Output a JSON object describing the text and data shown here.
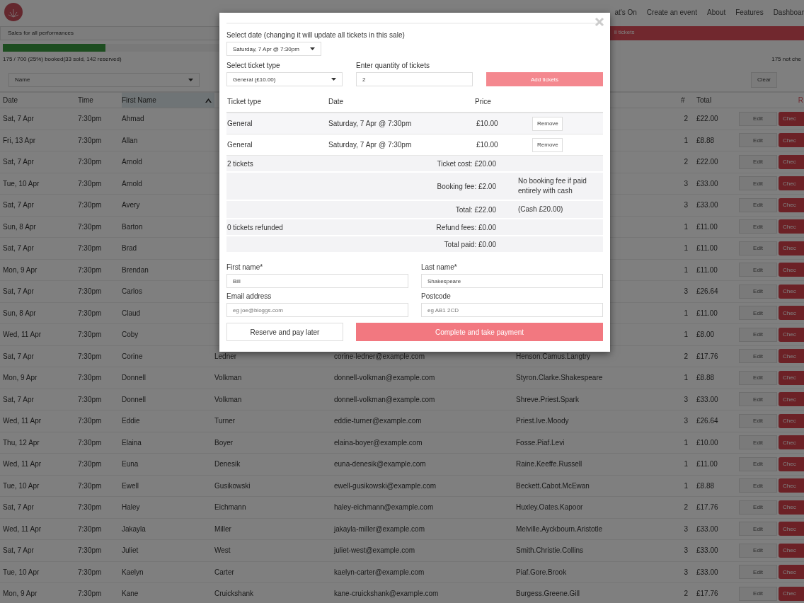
{
  "nav": {
    "links": [
      "at's On",
      "Create an event",
      "About",
      "Features",
      "Dashboar"
    ]
  },
  "sales": {
    "performance_select": "Sales for all performances",
    "alert": "ll tickets",
    "progress": {
      "level": 0.25
    },
    "booked_text": "175 / 700 (25%) booked(33 sold, 142 reserved)",
    "not_checked_text": "175 not che"
  },
  "filter": {
    "field_select": "Name",
    "clear_button": "Clear"
  },
  "table": {
    "columns": [
      {
        "label": "Date",
        "sorted": false
      },
      {
        "label": "Time",
        "sorted": false
      },
      {
        "label": "First Name",
        "sorted": true
      },
      {
        "label": "#",
        "sorted": false
      },
      {
        "label": "Total",
        "sorted": false
      },
      {
        "label": "R",
        "sorted": false
      }
    ],
    "rows": [
      {
        "date": "Sat, 7 Apr",
        "time": "7:30pm",
        "first_name": "Ahmad",
        "count": "2",
        "total": "£22.00",
        "edit": "Edit",
        "check": "Chec"
      },
      {
        "date": "Fri, 13 Apr",
        "time": "7:30pm",
        "first_name": "Allan",
        "count": "1",
        "total": "£8.88",
        "edit": "Edit",
        "check": "Chec"
      },
      {
        "date": "Sat, 7 Apr",
        "time": "7:30pm",
        "first_name": "Arnold",
        "count": "2",
        "total": "£22.00",
        "edit": "Edit",
        "check": "Chec"
      },
      {
        "date": "Tue, 10 Apr",
        "time": "7:30pm",
        "first_name": "Arnold",
        "count": "3",
        "total": "£33.00",
        "edit": "Edit",
        "check": "Chec"
      },
      {
        "date": "Sat, 7 Apr",
        "time": "7:30pm",
        "first_name": "Avery",
        "count": "3",
        "total": "£33.00",
        "edit": "Edit",
        "check": "Chec"
      },
      {
        "date": "Sun, 8 Apr",
        "time": "7:30pm",
        "first_name": "Barton",
        "count": "1",
        "total": "£11.00",
        "edit": "Edit",
        "check": "Chec"
      },
      {
        "date": "Sat, 7 Apr",
        "time": "7:30pm",
        "first_name": "Brad",
        "count": "1",
        "total": "£11.00",
        "edit": "Edit",
        "check": "Chec"
      },
      {
        "date": "Mon, 9 Apr",
        "time": "7:30pm",
        "first_name": "Brendan",
        "count": "1",
        "total": "£11.00",
        "edit": "Edit",
        "check": "Chec"
      },
      {
        "date": "Sat, 7 Apr",
        "time": "7:30pm",
        "first_name": "Carlos",
        "count": "3",
        "total": "£26.64",
        "edit": "Edit",
        "check": "Chec"
      },
      {
        "date": "Sun, 8 Apr",
        "time": "7:30pm",
        "first_name": "Claud",
        "count": "1",
        "total": "£11.00",
        "edit": "Edit",
        "check": "Chec"
      },
      {
        "date": "Wed, 11 Apr",
        "time": "7:30pm",
        "first_name": "Coby",
        "count": "1",
        "total": "£8.00",
        "edit": "Edit",
        "check": "Chec"
      },
      {
        "date": "Sat, 7 Apr",
        "time": "7:30pm",
        "first_name": "Corine",
        "last_name": "Ledner",
        "email": "corine-ledner@example.com",
        "seats": "Henson.Camus.Langtry",
        "count": "2",
        "total": "£17.76",
        "edit": "Edit",
        "check": "Chec"
      },
      {
        "date": "Mon, 9 Apr",
        "time": "7:30pm",
        "first_name": "Donnell",
        "last_name": "Volkman",
        "email": "donnell-volkman@example.com",
        "seats": "Styron.Clarke.Shakespeare",
        "count": "1",
        "total": "£8.88",
        "edit": "Edit",
        "check": "Chec"
      },
      {
        "date": "Sat, 7 Apr",
        "time": "7:30pm",
        "first_name": "Donnell",
        "last_name": "Volkman",
        "email": "donnell-volkman@example.com",
        "seats": "Shreve.Priest.Spark",
        "count": "3",
        "total": "£33.00",
        "edit": "Edit",
        "check": "Chec"
      },
      {
        "date": "Wed, 11 Apr",
        "time": "7:30pm",
        "first_name": "Eddie",
        "last_name": "Turner",
        "email": "eddie-turner@example.com",
        "seats": "Priest.Ive.Moody",
        "count": "3",
        "total": "£26.64",
        "edit": "Edit",
        "check": "Chec"
      },
      {
        "date": "Thu, 12 Apr",
        "time": "7:30pm",
        "first_name": "Elaina",
        "last_name": "Boyer",
        "email": "elaina-boyer@example.com",
        "seats": "Fosse.Piaf.Levi",
        "count": "1",
        "total": "£10.00",
        "edit": "Edit",
        "check": "Chec"
      },
      {
        "date": "Wed, 11 Apr",
        "time": "7:30pm",
        "first_name": "Euna",
        "last_name": "Denesik",
        "email": "euna-denesik@example.com",
        "seats": "Raine.Keeffe.Russell",
        "count": "1",
        "total": "£11.00",
        "edit": "Edit",
        "check": "Chec"
      },
      {
        "date": "Tue, 10 Apr",
        "time": "7:30pm",
        "first_name": "Ewell",
        "last_name": "Gusikowski",
        "email": "ewell-gusikowski@example.com",
        "seats": "Beckett.Cabot.McEwan",
        "count": "1",
        "total": "£8.88",
        "edit": "Edit",
        "check": "Chec"
      },
      {
        "date": "Sat, 7 Apr",
        "time": "7:30pm",
        "first_name": "Haley",
        "last_name": "Eichmann",
        "email": "haley-eichmann@example.com",
        "seats": "Huxley.Oates.Kapoor",
        "count": "2",
        "total": "£17.76",
        "edit": "Edit",
        "check": "Chec"
      },
      {
        "date": "Wed, 11 Apr",
        "time": "7:30pm",
        "first_name": "Jakayla",
        "last_name": "Miller",
        "email": "jakayla-miller@example.com",
        "seats": "Melville.Ayckbourn.Aristotle",
        "count": "3",
        "total": "£33.00",
        "edit": "Edit",
        "check": "Chec"
      },
      {
        "date": "Sat, 7 Apr",
        "time": "7:30pm",
        "first_name": "Juliet",
        "last_name": "West",
        "email": "juliet-west@example.com",
        "seats": "Smith.Christie.Collins",
        "count": "3",
        "total": "£33.00",
        "edit": "Edit",
        "check": "Chec"
      },
      {
        "date": "Tue, 10 Apr",
        "time": "7:30pm",
        "first_name": "Kaelyn",
        "last_name": "Carter",
        "email": "kaelyn-carter@example.com",
        "seats": "Piaf.Gore.Brook",
        "count": "3",
        "total": "£33.00",
        "edit": "Edit",
        "check": "Chec"
      },
      {
        "date": "Mon, 9 Apr",
        "time": "7:30pm",
        "first_name": "Kane",
        "last_name": "Cruickshank",
        "email": "kane-cruickshank@example.com",
        "seats": "Burgess.Greene.Gill",
        "count": "2",
        "total": "£17.76",
        "edit": "Edit",
        "check": "Chec"
      }
    ]
  },
  "modal": {
    "date_label": "Select date (changing it will update all tickets in this sale)",
    "date_value": "Saturday, 7 Apr @ 7:30pm",
    "ticket_type_label": "Select ticket type",
    "ticket_type_value": "General (£10.00)",
    "quantity_label": "Enter quantity of tickets",
    "quantity_value": "2",
    "add_button": "Add tickets",
    "ticket_columns": [
      "Ticket type",
      "Date",
      "Price"
    ],
    "tickets": [
      {
        "type": "General",
        "date": "Saturday, 7 Apr @ 7:30pm",
        "price": "£10.00",
        "action": "Remove"
      },
      {
        "type": "General",
        "date": "Saturday, 7 Apr @ 7:30pm",
        "price": "£10.00",
        "action": "Remove"
      }
    ],
    "summary": [
      {
        "left": "2 tickets",
        "middle": "Ticket cost: £20.00"
      },
      {
        "middle": "Booking fee: £2.00",
        "right": "No booking fee if paid entirely with cash"
      },
      {
        "middle": "Total: £22.00",
        "right": "(Cash £20.00)"
      },
      {
        "left": "0 tickets refunded",
        "middle": "Refund fees: £0.00"
      },
      {
        "middle": "Total paid: £0.00"
      }
    ],
    "fields": [
      {
        "label": "First name*",
        "value": "Bill"
      },
      {
        "label": "Last name*",
        "value": "Shakespeare"
      },
      {
        "label": "Email address",
        "placeholder": "eg joe@bloggs.com"
      },
      {
        "label": "Postcode",
        "placeholder": "eg AB1 2CD"
      }
    ],
    "reserve_button": "Reserve and pay later",
    "complete_button": "Complete and take payment"
  }
}
